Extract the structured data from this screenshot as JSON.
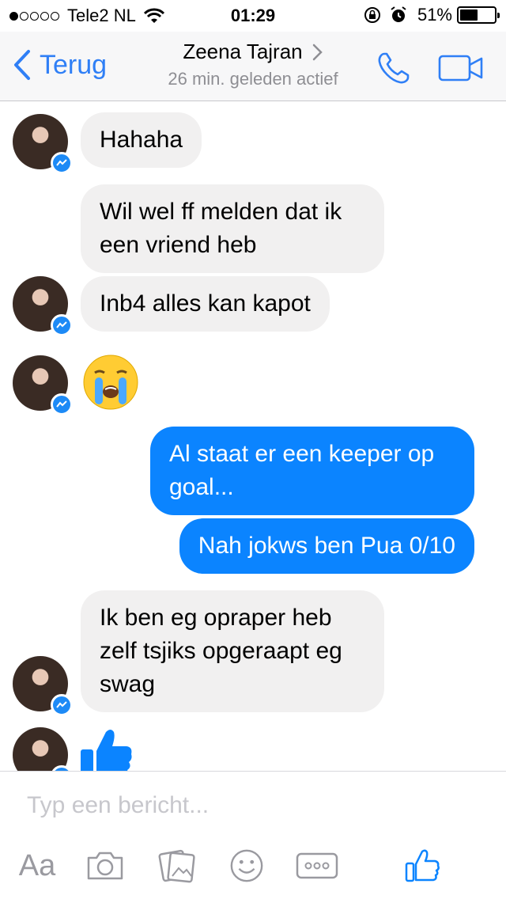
{
  "status_bar": {
    "carrier": "Tele2 NL",
    "time": "01:29",
    "battery": "51%",
    "battery_level": 0.51,
    "signal_bars": 1
  },
  "nav": {
    "back_label": "Terug",
    "contact_name": "Zeena Tajran",
    "subtitle": "26 min. geleden actief",
    "accent_color": "#2f7ff6"
  },
  "messages": [
    {
      "from": "contact",
      "text": "Hahaha"
    },
    {
      "from": "contact",
      "text": "Wil wel ff melden dat ik een vriend heb"
    },
    {
      "from": "contact",
      "text": "Inb4 alles kan kapot"
    },
    {
      "from": "contact",
      "emoji": "crying-face"
    },
    {
      "from": "me",
      "text": "Al staat er een keeper op goal..."
    },
    {
      "from": "me",
      "text": "Nah jokws ben Pua 0/10"
    },
    {
      "from": "contact",
      "text": "Ik ben eg opraper heb zelf tsjiks opgeraapt eg swag"
    },
    {
      "from": "contact",
      "emoji": "thumbs-up"
    }
  ],
  "composer": {
    "placeholder": "Typ een bericht...",
    "text_tool_label": "Aa",
    "icons": [
      "aa-icon",
      "camera-icon",
      "gallery-icon",
      "emoji-icon",
      "more-icon",
      "like-icon"
    ]
  }
}
